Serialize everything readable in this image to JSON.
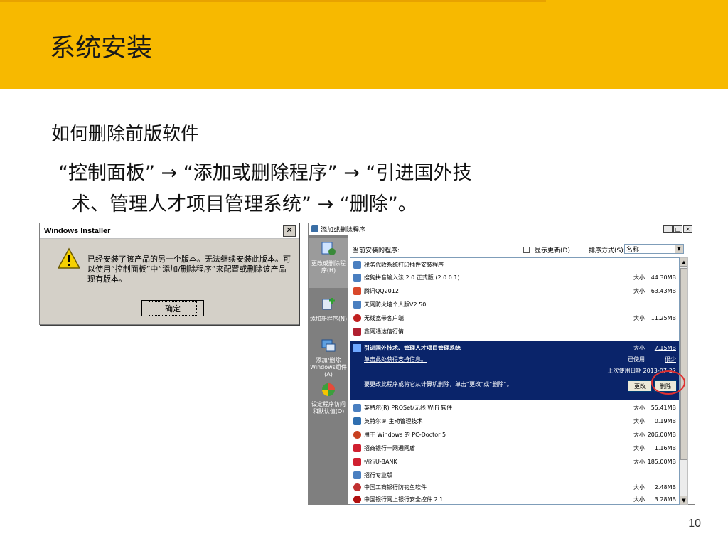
{
  "slide": {
    "title": "系统安装",
    "subtitle": "如何删除前版软件",
    "step_line1": "“控制面板” → “添加或删除程序” → “引进国外技",
    "step_line2": "术、管理人才项目管理系统” → “删除”。",
    "page_number": "10"
  },
  "dialog": {
    "title": "Windows Installer",
    "close_label": "✕",
    "message": "已经安装了该产品的另一个版本。无法继续安装此版本。可以使用“控制面板”中“添加/删除程序”来配置或删除该产品现有版本。",
    "ok_label": "确定",
    "icon": "warning-icon"
  },
  "arp": {
    "title": "添加或删除程序",
    "win_min": "_",
    "win_max": "□",
    "win_close": "✕",
    "sidebar": [
      {
        "label": "更改或删除程序(H)",
        "icon": "change-remove-icon"
      },
      {
        "label": "添加新程序(N)",
        "icon": "add-new-icon"
      },
      {
        "label": "添加/删除Windows组件(A)",
        "icon": "windows-components-icon"
      },
      {
        "label": "设定程序访问和默认值(O)",
        "icon": "defaults-icon"
      }
    ],
    "installed_label": "当前安装的程序:",
    "show_updates_label": "显示更新(D)",
    "sort_label": "排序方式(S):",
    "sort_value": "名称",
    "rows_top": [
      {
        "name": "税务代收系统打印插件安装程序",
        "size_label": "",
        "size": ""
      },
      {
        "name": "搜狗拼音输入法 2.0 正式版 (2.0.0.1)",
        "size_label": "大小",
        "size": "44.30MB"
      },
      {
        "name": "腾讯QQ2012",
        "size_label": "大小",
        "size": "63.43MB"
      },
      {
        "name": "天网防火墙个人版V2.50",
        "size_label": "",
        "size": ""
      },
      {
        "name": "无线宽带客户端",
        "size_label": "大小",
        "size": "11.25MB"
      },
      {
        "name": "鑫网通达信行情",
        "size_label": "",
        "size": ""
      }
    ],
    "selected": {
      "name": "引进国外技术、管理人才项目管理系统",
      "size_label": "大小",
      "size": "7.15MB",
      "support_link": "单击此处获得支持信息。",
      "used_label": "已使用",
      "used_value": "很少",
      "last_used_label": "上次使用日期",
      "last_used_value": "2013-07-22",
      "hint": "要更改此程序或将它从计算机删除，单击“更改”或“删除”。",
      "change_label": "更改",
      "remove_label": "删除"
    },
    "rows_bottom": [
      {
        "name": "英特尔(R) PROSet/无线 WiFi 软件",
        "size_label": "大小",
        "size": "55.41MB"
      },
      {
        "name": "英特尔® 主动管理技术",
        "size_label": "大小",
        "size": "0.19MB"
      },
      {
        "name": "用于 Windows 的 PC-Doctor 5",
        "size_label": "大小",
        "size": "206.00MB"
      },
      {
        "name": "招商银行一网通网盾",
        "size_label": "大小",
        "size": "1.16MB"
      },
      {
        "name": "招行U-BANK",
        "size_label": "大小",
        "size": "185.00MB"
      },
      {
        "name": "招行专业版",
        "size_label": "",
        "size": ""
      },
      {
        "name": "中国工商银行防钓鱼软件",
        "size_label": "大小",
        "size": "2.48MB"
      },
      {
        "name": "中国银行网上银行安全控件 2.1",
        "size_label": "大小",
        "size": "3.28MB"
      }
    ]
  },
  "colors": {
    "band": "#f7b900",
    "selection": "#0a246a",
    "circle": "#e03030"
  }
}
